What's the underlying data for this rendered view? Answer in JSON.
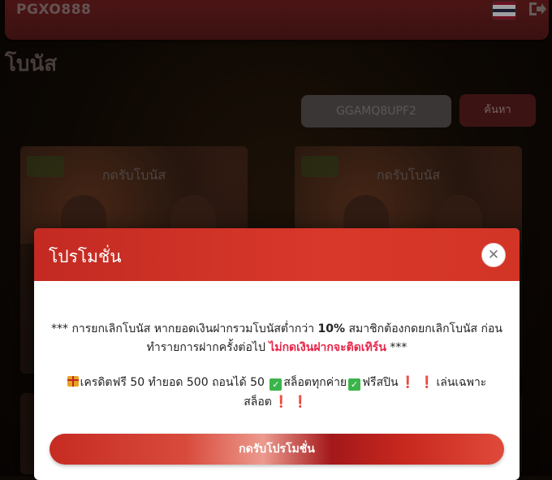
{
  "header": {
    "logo": "PGXO888",
    "flag_colors": [
      "#a51931",
      "#f4f5f8",
      "#2d2a4a",
      "#f4f5f8",
      "#a51931"
    ],
    "flag_icon": "thai-flag-icon",
    "logout_icon": "logout-icon"
  },
  "page": {
    "title": "โบนัส"
  },
  "search": {
    "code_value": "GGAMQ8UPF2",
    "button_label": "ค้นหา"
  },
  "cards": [
    {
      "title": "กดรับโบนัส"
    },
    {
      "title": "กดรับโบนัส"
    }
  ],
  "modal": {
    "title": "โปรโมชั่น",
    "close_icon": "close-icon",
    "para1_prefix": "*** การยกเลิกโบนัส หากยอดเงินฝากรวมโบนัสต่ำกว่า ",
    "para1_bold": "10%",
    "para1_mid": " สมาชิกต้องกดยกเลิกโบนัส ก่อนทำรายการฝากครั้งต่อไป ",
    "para1_pink": "ไม่กดเงินฝากจะติดเทิร์น",
    "para1_suffix": " ***",
    "para2_part1": "เครดิตฟรี 50 ทำยอด 500 ถอนได้ 50 ",
    "para2_part2": "สล็อตทุกค่าย",
    "para2_part3": "ฟรีสปิน",
    "para2_part4": "เล่นเฉพาะ สล็อต",
    "check_glyph": "✓",
    "exclaim_glyph": "❗",
    "claim_button": "กดรับโปรโมชั่น",
    "accent_color": "#d8382a"
  }
}
